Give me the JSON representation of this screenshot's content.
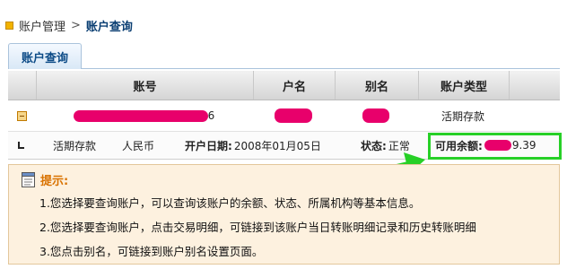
{
  "breadcrumb": {
    "parent": "账户管理",
    "separator": ">",
    "current": "账户查询"
  },
  "tabs": [
    {
      "label": "账户查询",
      "active": true
    }
  ],
  "table": {
    "headers": [
      "账号",
      "户名",
      "别名",
      "账户类型"
    ],
    "row": {
      "account_suffix": "6",
      "account_type": "活期存款"
    },
    "detail": {
      "deposit_type": "活期存款",
      "currency": "人民币",
      "open_date_label": "开户日期:",
      "open_date": "2008年01月05日",
      "status_label": "状态:",
      "status": "正常",
      "balance_label": "可用余额:",
      "balance_suffix": "9.39"
    }
  },
  "tips": {
    "title": "提示:",
    "items": [
      "1.您选择要查询账户，可以查询该账户的余额、状态、所属机构等基本信息。",
      "2.您选择要查询账户，点击交易明细，可链接到该账户当日转账明细记录和历史转账明细",
      "3.您点击别名，可链接到账户别名设置页面。"
    ]
  },
  "colors": {
    "redaction": "#e8006b",
    "highlight": "#27d027",
    "tab_text": "#0b4a86",
    "tips_title": "#d97200"
  }
}
